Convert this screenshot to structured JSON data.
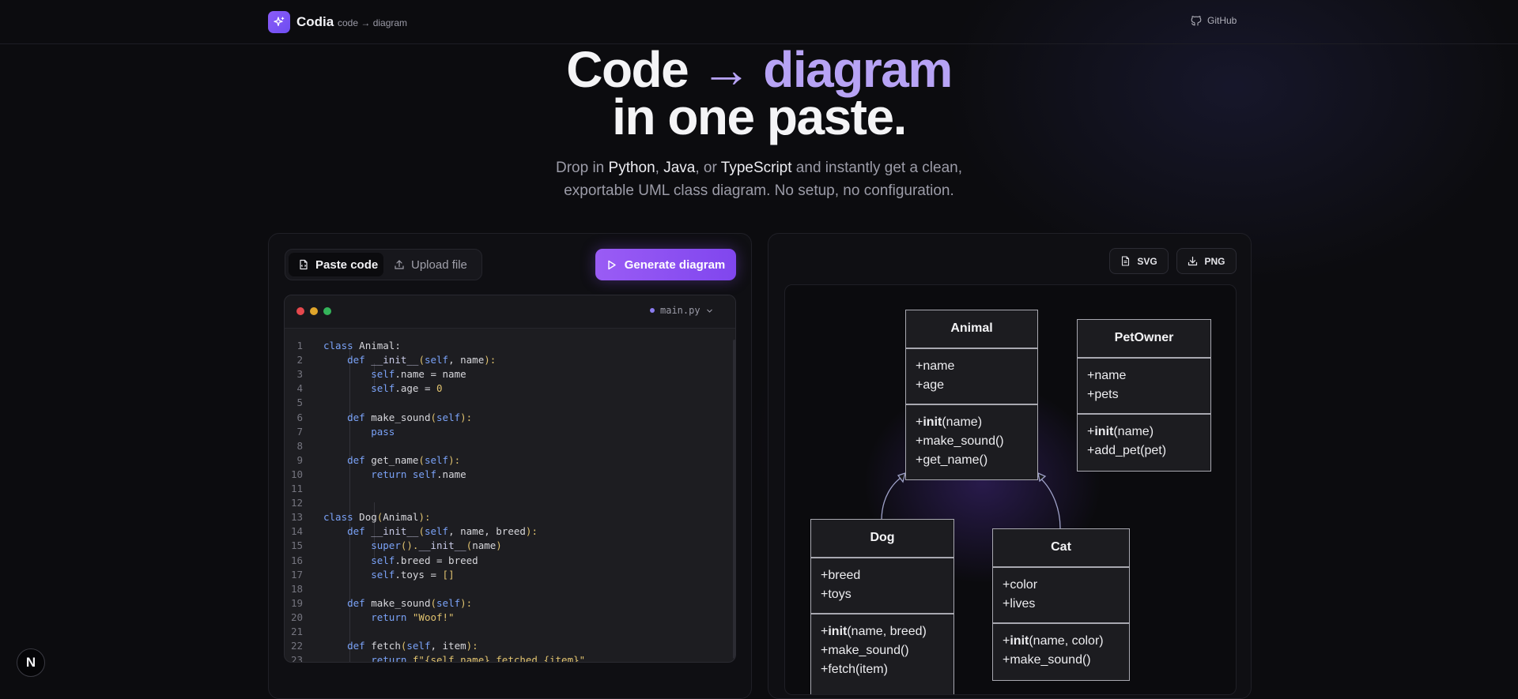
{
  "nav": {
    "brand": "Codia",
    "tagline": "code → diagram",
    "github_label": "GitHub"
  },
  "hero": {
    "line1_a": "Code",
    "line1_arrow": "→",
    "line1_b": "diagram",
    "line2": "in one paste.",
    "sub_pre": "Drop in ",
    "sub_lang1": "Python",
    "sub_comma1": ", ",
    "sub_lang2": "Java",
    "sub_or": ", or ",
    "sub_lang3": "TypeScript",
    "sub_post": " and instantly get a clean,",
    "sub_line2": "exportable UML class diagram. No setup, no configuration."
  },
  "input": {
    "tab_paste": "Paste code",
    "tab_upload": "Upload file",
    "generate": "Generate diagram",
    "filename": "main.py"
  },
  "code": [
    {
      "n": "1",
      "t": [
        [
          "class",
          "k"
        ],
        [
          " Animal:",
          ""
        ]
      ]
    },
    {
      "n": "2",
      "t": [
        [
          "    ",
          ""
        ],
        [
          "def",
          "k"
        ],
        [
          " ",
          ""
        ],
        [
          "__init__",
          "f"
        ],
        [
          "(",
          "pn"
        ],
        [
          "self",
          "k"
        ],
        [
          ", name",
          ""
        ],
        [
          "):",
          "pn"
        ]
      ]
    },
    {
      "n": "3",
      "t": [
        [
          "        ",
          ""
        ],
        [
          "self",
          "k"
        ],
        [
          ".name = name",
          ""
        ]
      ]
    },
    {
      "n": "4",
      "t": [
        [
          "        ",
          ""
        ],
        [
          "self",
          "k"
        ],
        [
          ".age = ",
          ""
        ],
        [
          "0",
          "n"
        ]
      ]
    },
    {
      "n": "5",
      "t": []
    },
    {
      "n": "6",
      "t": [
        [
          "    ",
          ""
        ],
        [
          "def",
          "k"
        ],
        [
          " make_sound",
          ""
        ],
        [
          "(",
          "pn"
        ],
        [
          "self",
          "k"
        ],
        [
          "):",
          "pn"
        ]
      ]
    },
    {
      "n": "7",
      "t": [
        [
          "        ",
          ""
        ],
        [
          "pass",
          "k"
        ]
      ]
    },
    {
      "n": "8",
      "t": []
    },
    {
      "n": "9",
      "t": [
        [
          "    ",
          ""
        ],
        [
          "def",
          "k"
        ],
        [
          " get_name",
          ""
        ],
        [
          "(",
          "pn"
        ],
        [
          "self",
          "k"
        ],
        [
          "):",
          "pn"
        ]
      ]
    },
    {
      "n": "10",
      "t": [
        [
          "        ",
          ""
        ],
        [
          "return",
          "k"
        ],
        [
          " ",
          ""
        ],
        [
          "self",
          "k"
        ],
        [
          ".name",
          ""
        ]
      ]
    },
    {
      "n": "11",
      "t": []
    },
    {
      "n": "12",
      "t": []
    },
    {
      "n": "13",
      "t": [
        [
          "class",
          "k"
        ],
        [
          " Dog",
          ""
        ],
        [
          "(",
          "pn"
        ],
        [
          "Animal",
          ""
        ],
        [
          "):",
          "pn"
        ]
      ]
    },
    {
      "n": "14",
      "t": [
        [
          "    ",
          ""
        ],
        [
          "def",
          "k"
        ],
        [
          " ",
          ""
        ],
        [
          "__init__",
          "f"
        ],
        [
          "(",
          "pn"
        ],
        [
          "self",
          "k"
        ],
        [
          ", name, breed",
          ""
        ],
        [
          "):",
          "pn"
        ]
      ]
    },
    {
      "n": "15",
      "t": [
        [
          "        ",
          ""
        ],
        [
          "super",
          "k"
        ],
        [
          "().",
          "pn"
        ],
        [
          "__init__",
          "f"
        ],
        [
          "(",
          "pn"
        ],
        [
          "name",
          ""
        ],
        [
          ")",
          "pn"
        ]
      ]
    },
    {
      "n": "16",
      "t": [
        [
          "        ",
          ""
        ],
        [
          "self",
          "k"
        ],
        [
          ".breed = breed",
          ""
        ]
      ]
    },
    {
      "n": "17",
      "t": [
        [
          "        ",
          ""
        ],
        [
          "self",
          "k"
        ],
        [
          ".toys = ",
          ""
        ],
        [
          "[]",
          "pn"
        ]
      ]
    },
    {
      "n": "18",
      "t": []
    },
    {
      "n": "19",
      "t": [
        [
          "    ",
          ""
        ],
        [
          "def",
          "k"
        ],
        [
          " make_sound",
          ""
        ],
        [
          "(",
          "pn"
        ],
        [
          "self",
          "k"
        ],
        [
          "):",
          "pn"
        ]
      ]
    },
    {
      "n": "20",
      "t": [
        [
          "        ",
          ""
        ],
        [
          "return",
          "k"
        ],
        [
          " ",
          ""
        ],
        [
          "\"Woof!\"",
          "s"
        ]
      ]
    },
    {
      "n": "21",
      "t": []
    },
    {
      "n": "22",
      "t": [
        [
          "    ",
          ""
        ],
        [
          "def",
          "k"
        ],
        [
          " fetch",
          ""
        ],
        [
          "(",
          "pn"
        ],
        [
          "self",
          "k"
        ],
        [
          ", item",
          ""
        ],
        [
          "):",
          "pn"
        ]
      ]
    },
    {
      "n": "23",
      "t": [
        [
          "        ",
          ""
        ],
        [
          "return",
          "k"
        ],
        [
          " ",
          ""
        ],
        [
          "f\"{self.name} fetched {item}\"",
          "s"
        ]
      ]
    }
  ],
  "export": {
    "svg": "SVG",
    "png": "PNG"
  },
  "diagram": {
    "animal": {
      "name": "Animal",
      "attrs": [
        "+name",
        "+age"
      ],
      "methods": [
        [
          "+",
          "init",
          "(name)"
        ],
        [
          "+make_sound()",
          "",
          ""
        ],
        [
          "+get_name()",
          "",
          ""
        ]
      ]
    },
    "petowner": {
      "name": "PetOwner",
      "attrs": [
        "+name",
        "+pets"
      ],
      "methods": [
        [
          "+",
          "init",
          "(name)"
        ],
        [
          "+add_pet(pet)",
          "",
          ""
        ]
      ]
    },
    "dog": {
      "name": "Dog",
      "attrs": [
        "+breed",
        "+toys"
      ],
      "methods": [
        [
          "+",
          "init",
          "(name, breed)"
        ],
        [
          "+make_sound()",
          "",
          ""
        ],
        [
          "+fetch(item)",
          "",
          ""
        ]
      ]
    },
    "cat": {
      "name": "Cat",
      "attrs": [
        "+color",
        "+lives"
      ],
      "methods": [
        [
          "+",
          "init",
          "(name, color)"
        ],
        [
          "+make_sound()",
          "",
          ""
        ]
      ]
    }
  },
  "fab_label": "N",
  "colors": {
    "accent": "#8b5cf6",
    "accent_text": "#b7a3f5",
    "keyword": "#7aa2f7",
    "string": "#e0c26f"
  }
}
